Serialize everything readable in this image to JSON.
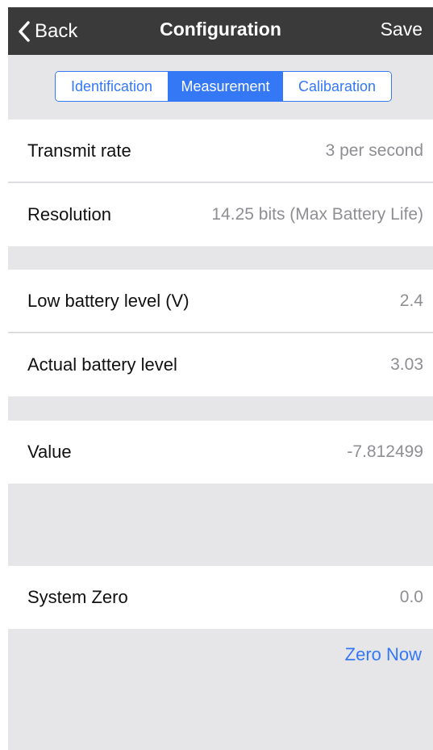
{
  "navbar": {
    "back_label": "Back",
    "title": "Configuration",
    "save_label": "Save"
  },
  "tabs": [
    {
      "label": "Identification",
      "active": false
    },
    {
      "label": "Measurement",
      "active": true
    },
    {
      "label": "Calibaration",
      "active": false
    }
  ],
  "rows": {
    "transmit_rate": {
      "label": "Transmit rate",
      "value": "3 per second"
    },
    "resolution": {
      "label": "Resolution",
      "value": "14.25 bits (Max Battery Life)"
    },
    "low_battery": {
      "label": "Low battery level (V)",
      "value": "2.4"
    },
    "actual_battery": {
      "label": "Actual battery level",
      "value": "3.03"
    },
    "value": {
      "label": "Value",
      "value": "-7.812499"
    },
    "system_zero": {
      "label": "System Zero",
      "value": "0.0"
    }
  },
  "actions": {
    "zero_now_label": "Zero Now"
  },
  "colors": {
    "accent": "#3478f6",
    "navbar_bg": "#3a3a3a",
    "group_bg": "#e6e6e8",
    "secondary_text": "#8e8e93"
  },
  "icons": {
    "back": "chevron-left-icon"
  }
}
